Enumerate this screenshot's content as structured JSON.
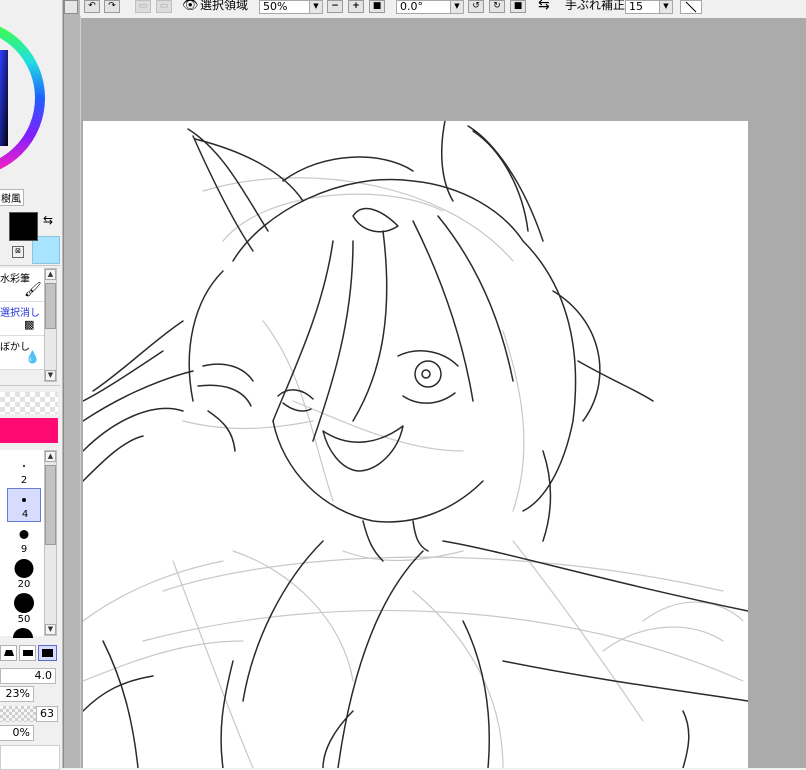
{
  "toolbar": {
    "selection_label": "選択領域",
    "zoom": "50%",
    "rotation": "0.0°",
    "stabilizer_label": "手ぶれ補正",
    "stabilizer_value": "15"
  },
  "left": {
    "tab_label": "樹風",
    "tools": [
      {
        "label": "水彩筆",
        "icon": "brush-icon"
      },
      {
        "label": "選択消し",
        "icon": "select-eraser-icon"
      },
      {
        "label": "ぼかし",
        "icon": "blur-drop-icon"
      }
    ],
    "brush_sizes": [
      "2",
      "4",
      "9",
      "20",
      "50"
    ],
    "size_value": "4.0",
    "min_size": "23%",
    "density": "63",
    "blend": "0%"
  },
  "colors": {
    "primary": "#000000",
    "secondary": "#a8e4ff",
    "pink_bar": "#ff0a73",
    "canvas_bg": "#ababab"
  }
}
